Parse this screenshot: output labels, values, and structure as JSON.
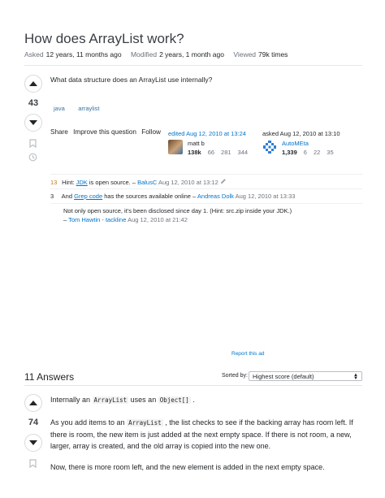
{
  "question": {
    "title": "How does ArrayList work?",
    "meta": [
      {
        "label": "Asked",
        "value": "12 years, 11 months ago"
      },
      {
        "label": "Modified",
        "value": "2 years, 1 month ago"
      },
      {
        "label": "Viewed",
        "value": "79k times"
      }
    ],
    "score": "43",
    "body": "What data structure does an ArrayList use internally?",
    "tags": [
      "java",
      "arraylist"
    ],
    "menu": [
      "Share",
      "Improve this question",
      "Follow"
    ],
    "editor": {
      "action": "edited Aug 12, 2010 at 13:24",
      "name": "matt b",
      "rep": "138k",
      "gold": "66",
      "silver": "281",
      "bronze": "344"
    },
    "owner": {
      "action": "asked Aug 12, 2010 at 13:10",
      "name": "AutoMEta",
      "rep": "1,339",
      "gold": "6",
      "silver": "22",
      "bronze": "35"
    }
  },
  "comments": [
    {
      "score": "13",
      "pre": "Hint: ",
      "link": "JDK",
      "post": " is open source. –",
      "user": "BalusC",
      "date": "Aug 12, 2010 at 13:12"
    },
    {
      "score": "3",
      "pre": "And ",
      "link": "Grep code",
      "post": " has the sources available online –",
      "user": "Andreas Dolk",
      "date": "Aug 12, 2010 at 13:33"
    },
    {
      "score": "",
      "text": "Not only open source, it's been disclosed since day 1. (Hint: src.zip inside your JDK.)",
      "dash": "–",
      "user": "Tom Hawtin - tackline",
      "date": "Aug 12, 2010 at 21:42"
    }
  ],
  "ad_label": "Report this ad",
  "answers": {
    "heading": "11 Answers",
    "sorted_by": "Sorted by:",
    "sort_value": "Highest score (default)",
    "score": "74",
    "p1_a": "Internally an ",
    "p1_code1": "ArrayList",
    "p1_b": " uses an ",
    "p1_code2": "Object[]",
    "p1_c": " .",
    "p2_a": "As you add items to an ",
    "p2_code": "ArrayList",
    "p2_b": " , the list checks to see if the backing array has room left. If there is room, the new item is just added at the next empty space. If there is not room, a new, larger, array is created, and the old array is copied into the new one.",
    "p3": "Now, there is more room left, and the new element is added in the next empty space."
  }
}
